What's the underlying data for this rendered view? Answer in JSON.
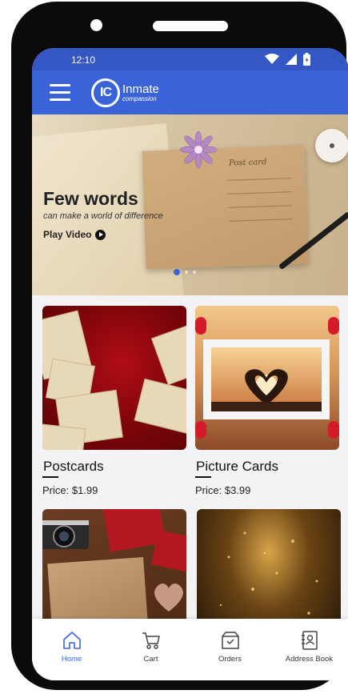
{
  "status_bar": {
    "time": "12:10"
  },
  "app_bar": {
    "logo_initials": "IC",
    "logo_name": "Inmate",
    "logo_tagline": "compassion"
  },
  "banner": {
    "headline": "Few words",
    "subheadline": "can make a world of difference",
    "cta": "Play Video",
    "postcard_label": "Post card",
    "slides": 3,
    "active_slide": 1
  },
  "products": [
    {
      "title": "Postcards",
      "price": "Price: $1.99",
      "image": "vintage-postcards-image"
    },
    {
      "title": "Picture Cards",
      "price": "Price: $3.99",
      "image": "heart-hands-sunset-image"
    },
    {
      "title": "",
      "price": "",
      "image": "gift-box-camera-image"
    },
    {
      "title": "",
      "price": "",
      "image": "glowing-book-image"
    }
  ],
  "bottom_nav": {
    "items": [
      {
        "label": "Home",
        "icon": "home-icon",
        "active": true
      },
      {
        "label": "Cart",
        "icon": "cart-icon",
        "active": false
      },
      {
        "label": "Orders",
        "icon": "orders-icon",
        "active": false
      },
      {
        "label": "Address Book",
        "icon": "address-book-icon",
        "active": false
      }
    ]
  },
  "colors": {
    "primary": "#3a63d8",
    "status_bar": "#3557c4",
    "background": "#f3f3f5"
  }
}
